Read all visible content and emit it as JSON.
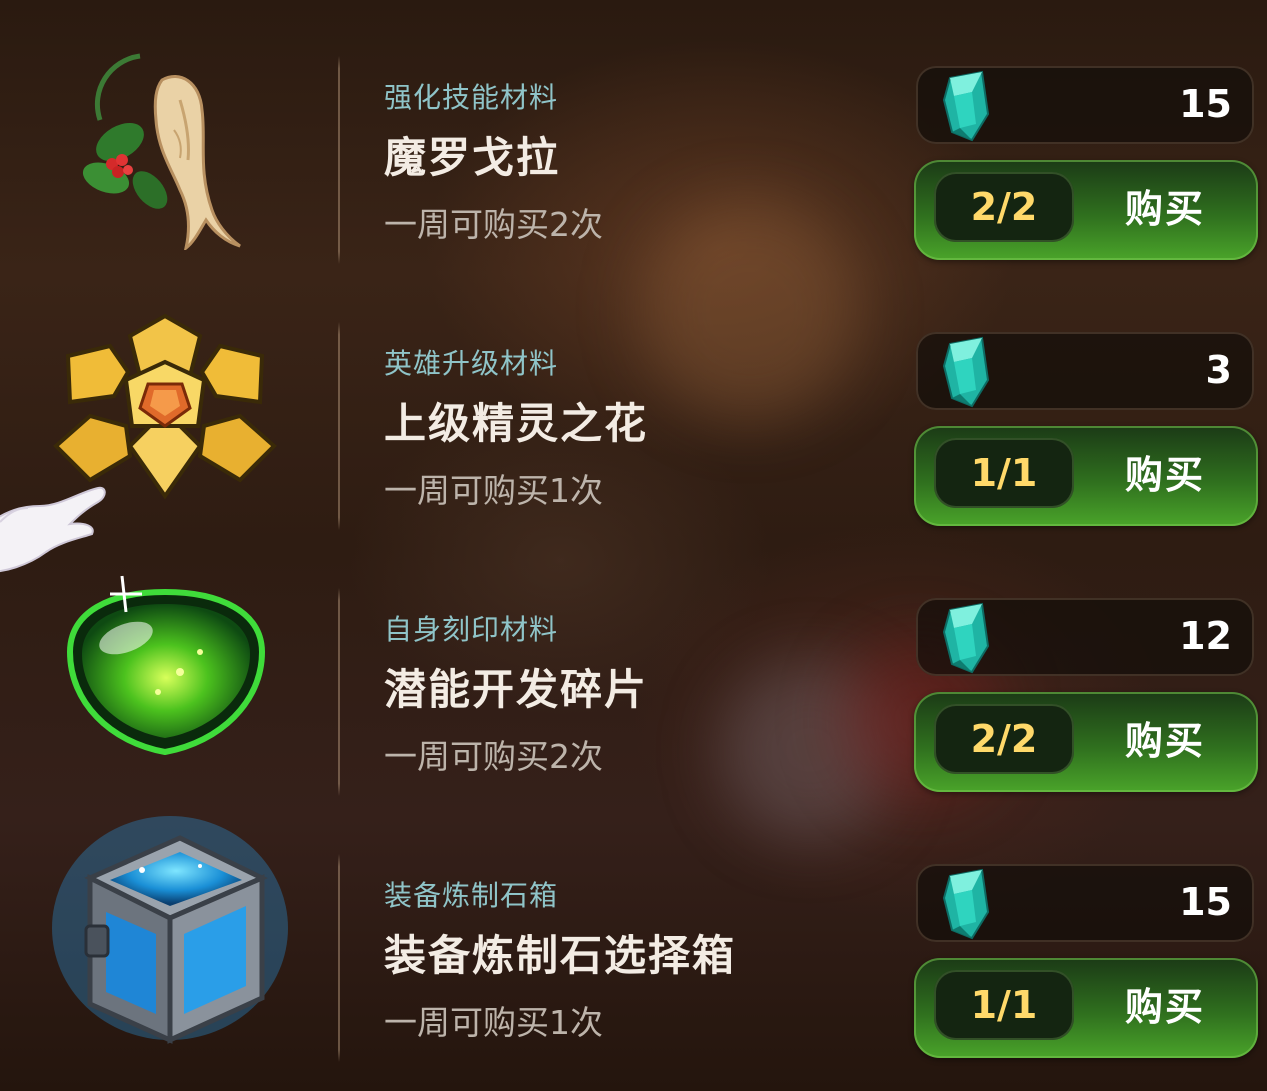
{
  "currency_icon": "teal-crystal-icon",
  "accent_colors": {
    "category_text": "#8fc4c8",
    "count_text": "#ffd96a",
    "button_green": "#3f8f24"
  },
  "items": [
    {
      "icon": "ginseng-root-icon",
      "category": "强化技能材料",
      "name": "魔罗戈拉",
      "limit": "一周可购买2次",
      "price": "15",
      "count": "2/2",
      "buy_label": "购买"
    },
    {
      "icon": "golden-flower-crystal-icon",
      "category": "英雄升级材料",
      "name": "上级精灵之花",
      "limit": "一周可购买1次",
      "price": "3",
      "count": "1/1",
      "buy_label": "购买"
    },
    {
      "icon": "green-orb-fragment-icon",
      "category": "自身刻印材料",
      "name": "潜能开发碎片",
      "limit": "一周可购买2次",
      "price": "12",
      "count": "2/2",
      "buy_label": "购买"
    },
    {
      "icon": "blue-treasure-chest-icon",
      "category": "装备炼制石箱",
      "name": "装备炼制石选择箱",
      "limit": "一周可购买1次",
      "price": "15",
      "count": "1/1",
      "buy_label": "购买"
    }
  ]
}
